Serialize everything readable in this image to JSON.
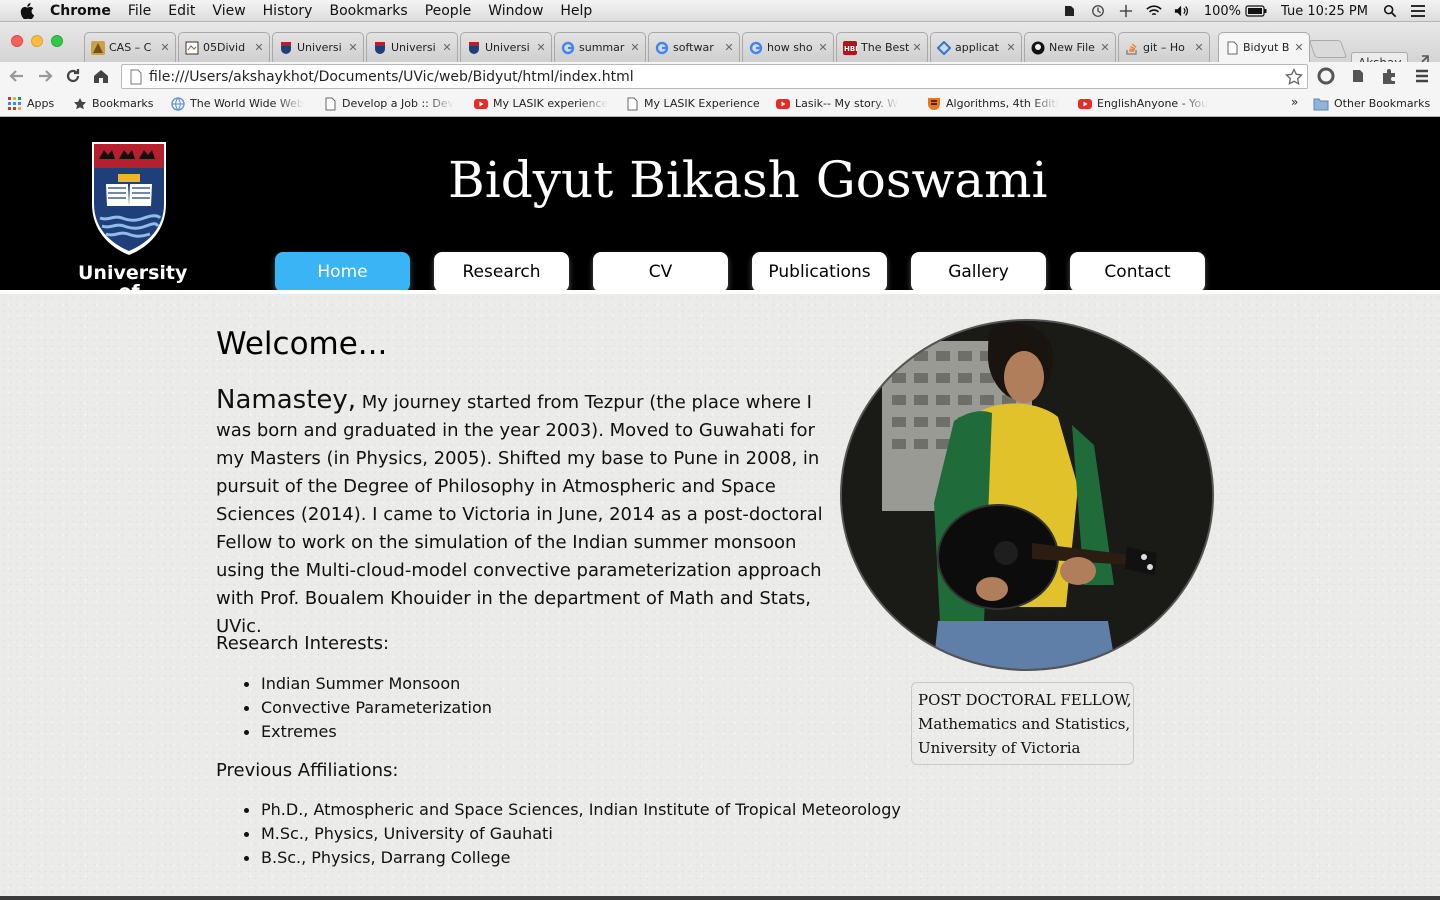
{
  "menubar": {
    "app": "Chrome",
    "items": [
      "File",
      "Edit",
      "View",
      "History",
      "Bookmarks",
      "People",
      "Window",
      "Help"
    ],
    "battery": "100%",
    "clock": "Tue 10:25 PM"
  },
  "tabs": [
    {
      "title": "CAS – C",
      "icon": "cas-icon"
    },
    {
      "title": "05Divid",
      "icon": "doc-icon"
    },
    {
      "title": "Universi",
      "icon": "uvic-icon"
    },
    {
      "title": "Universi",
      "icon": "uvic-icon"
    },
    {
      "title": "Universi",
      "icon": "uvic-icon"
    },
    {
      "title": "summar",
      "icon": "google-icon"
    },
    {
      "title": "softwar",
      "icon": "google-icon"
    },
    {
      "title": "how sho",
      "icon": "google-icon"
    },
    {
      "title": "The Best",
      "icon": "hbr-icon"
    },
    {
      "title": "applicat",
      "icon": "diamond-icon"
    },
    {
      "title": "New File",
      "icon": "github-icon"
    },
    {
      "title": "git – Ho",
      "icon": "stackoverflow-icon"
    },
    {
      "title": "Bidyut B",
      "icon": "page-icon"
    }
  ],
  "profile": "Akshay",
  "url": "file:///Users/akshaykhot/Documents/UVic/web/Bidyut/html/index.html",
  "bookmarks": [
    {
      "label": "Apps"
    },
    {
      "label": "Bookmarks"
    },
    {
      "label": "The World Wide Web"
    },
    {
      "label": "Develop a Job :: Dev"
    },
    {
      "label": "My LASIK experience"
    },
    {
      "label": "My LASIK Experience"
    },
    {
      "label": "Lasik-- My story. W"
    },
    {
      "label": "Algorithms, 4th Editi"
    },
    {
      "label": "EnglishAnyone - You"
    }
  ],
  "other_bookmarks": "Other Bookmarks",
  "chevron": "»",
  "site": {
    "logo_line1": "University",
    "logo_line2": "of Victoria",
    "title": "Bidyut Bikash Goswami",
    "nav": [
      "Home",
      "Research",
      "CV",
      "Publications",
      "Gallery",
      "Contact"
    ],
    "welcome": "Welcome...",
    "greeting": "Namastey,",
    "intro": "My journey started from Tezpur (the place where I was born and graduated in the year 2003). Moved to Guwahati for my Masters (in Physics, 2005). Shifted my base to Pune in 2008, in pursuit of the Degree of Philosophy in Atmospheric and Space Sciences (2014). I came to Victoria in June, 2014 as a post-doctoral Fellow to work on the simulation of the Indian summer monsoon using the Multi-cloud-model convective parameterization approach with Prof. Boualem Khouider in the department of Math and Stats, UVic.",
    "research_heading": "Research Interests:",
    "research": [
      "Indian Summer Monsoon",
      "Convective Parameterization",
      "Extremes"
    ],
    "affiliations_heading": "Previous Affiliations:",
    "affiliations": [
      "Ph.D., Atmospheric and Space Sciences, Indian Institute of Tropical Meteorology",
      "M.Sc., Physics, University of Gauhati",
      "B.Sc., Physics, Darrang College"
    ],
    "caption": [
      "POST DOCTORAL FELLOW,",
      "Mathematics and Statistics,",
      "University of Victoria"
    ]
  }
}
